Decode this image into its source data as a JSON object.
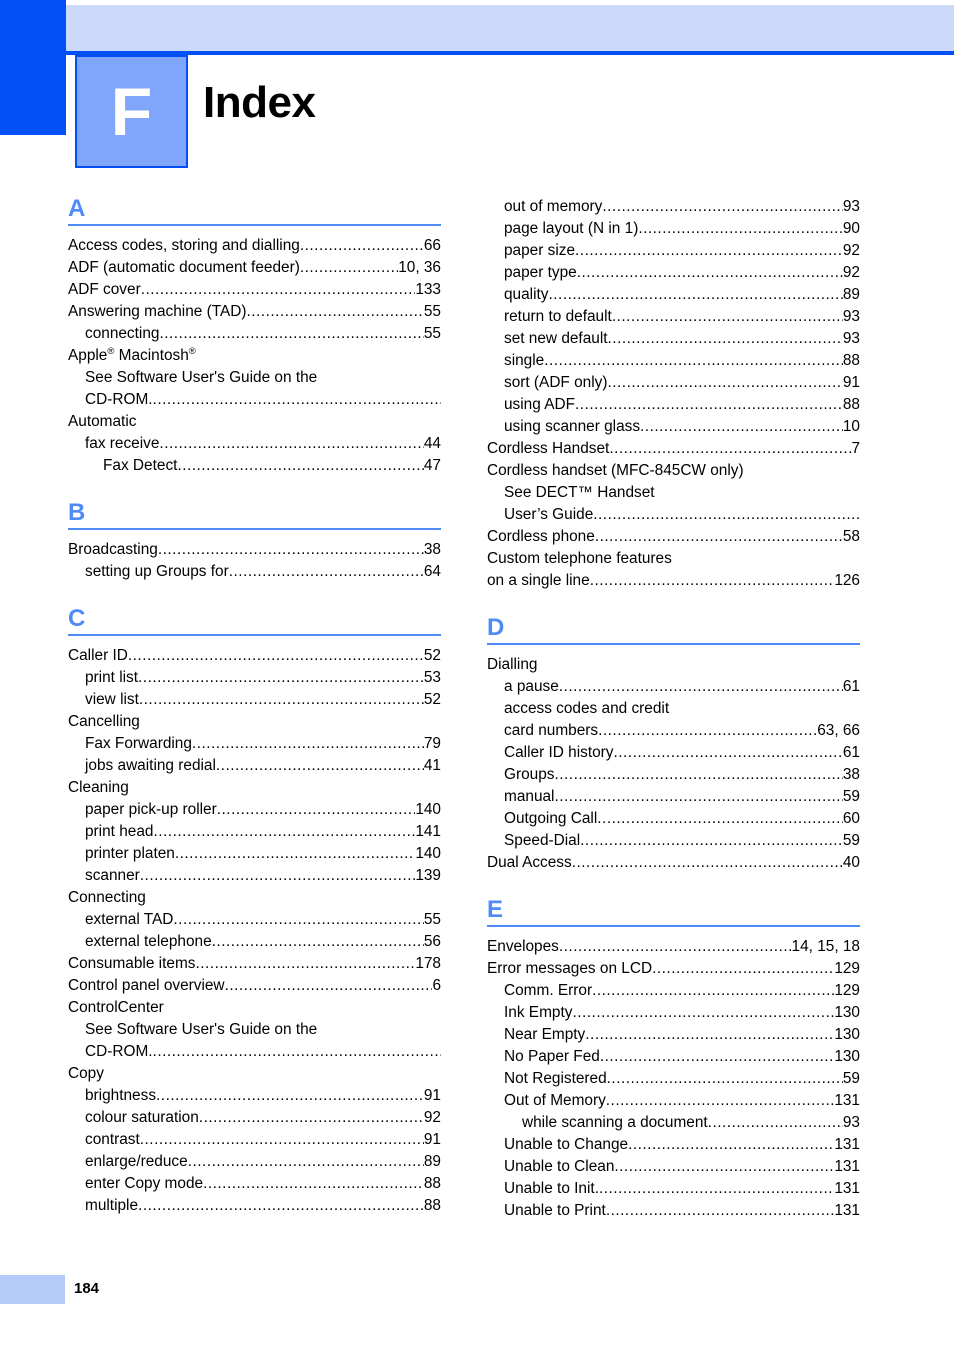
{
  "header": {
    "chapter_letter": "F",
    "title": "Index",
    "accent_dark": "#0050f5",
    "accent_band": "#cbdafb",
    "accent_tab": "#80a6fb"
  },
  "footer": {
    "page_number": "184",
    "bar_color": "#b4caf9"
  },
  "columns": [
    {
      "id": "left",
      "sections": [
        {
          "letter": "A",
          "entries": [
            {
              "level": 1,
              "label": "Access codes, storing and dialling",
              "page": "66",
              "dots": true
            },
            {
              "level": 1,
              "label": "ADF (automatic document feeder)",
              "page": "10, 36",
              "dots": true
            },
            {
              "level": 1,
              "label": "ADF cover",
              "page": "133",
              "dots": true
            },
            {
              "level": 1,
              "label": "Answering machine (TAD)",
              "page": "55",
              "dots": true
            },
            {
              "level": 2,
              "label": "connecting",
              "page": "55",
              "dots": true
            },
            {
              "level": 1,
              "label": "Apple® Macintosh®",
              "page": "",
              "dots": false,
              "html": true
            },
            {
              "level": 2,
              "label": "See Software User's Guide on the",
              "page": "",
              "dots": false
            },
            {
              "level": 2,
              "label": "CD-ROM.",
              "page": "",
              "dots": true
            },
            {
              "level": 1,
              "label": "Automatic",
              "page": "",
              "dots": false
            },
            {
              "level": 2,
              "label": "fax receive",
              "page": "44",
              "dots": true
            },
            {
              "level": 3,
              "label": "Fax Detect",
              "page": "47",
              "dots": true
            }
          ]
        },
        {
          "letter": "B",
          "entries": [
            {
              "level": 1,
              "label": "Broadcasting",
              "page": "38",
              "dots": true
            },
            {
              "level": 2,
              "label": "setting up Groups for",
              "page": "64",
              "dots": true
            }
          ]
        },
        {
          "letter": "C",
          "entries": [
            {
              "level": 1,
              "label": "Caller ID",
              "page": "52",
              "dots": true
            },
            {
              "level": 2,
              "label": "print list",
              "page": "53",
              "dots": true
            },
            {
              "level": 2,
              "label": "view list",
              "page": "52",
              "dots": true
            },
            {
              "level": 1,
              "label": "Cancelling",
              "page": "",
              "dots": false
            },
            {
              "level": 2,
              "label": "Fax Forwarding",
              "page": "79",
              "dots": true
            },
            {
              "level": 2,
              "label": "jobs awaiting redial",
              "page": "41",
              "dots": true
            },
            {
              "level": 1,
              "label": "Cleaning",
              "page": "",
              "dots": false
            },
            {
              "level": 2,
              "label": "paper pick-up roller",
              "page": "140",
              "dots": true
            },
            {
              "level": 2,
              "label": "print head",
              "page": "141",
              "dots": true
            },
            {
              "level": 2,
              "label": "printer platen",
              "page": "140",
              "dots": true
            },
            {
              "level": 2,
              "label": "scanner",
              "page": "139",
              "dots": true
            },
            {
              "level": 1,
              "label": "Connecting",
              "page": "",
              "dots": false
            },
            {
              "level": 2,
              "label": "external TAD",
              "page": "55",
              "dots": true
            },
            {
              "level": 2,
              "label": "external telephone",
              "page": "56",
              "dots": true
            },
            {
              "level": 1,
              "label": "Consumable items",
              "page": "178",
              "dots": true
            },
            {
              "level": 1,
              "label": "Control panel overview",
              "page": "6",
              "dots": true
            },
            {
              "level": 1,
              "label": "ControlCenter",
              "page": "",
              "dots": false
            },
            {
              "level": 2,
              "label": "See Software User's Guide on the",
              "page": "",
              "dots": false
            },
            {
              "level": 2,
              "label": "CD-ROM.",
              "page": "",
              "dots": true
            },
            {
              "level": 1,
              "label": "Copy",
              "page": "",
              "dots": false
            },
            {
              "level": 2,
              "label": "brightness",
              "page": "91",
              "dots": true
            },
            {
              "level": 2,
              "label": "colour saturation",
              "page": "92",
              "dots": true
            },
            {
              "level": 2,
              "label": "contrast",
              "page": "91",
              "dots": true
            },
            {
              "level": 2,
              "label": "enlarge/reduce",
              "page": "89",
              "dots": true
            },
            {
              "level": 2,
              "label": "enter Copy mode",
              "page": "88",
              "dots": true
            },
            {
              "level": 2,
              "label": "multiple",
              "page": "88",
              "dots": true
            }
          ]
        }
      ]
    },
    {
      "id": "right",
      "sections": [
        {
          "letter": "",
          "entries": [
            {
              "level": 2,
              "label": "out of memory",
              "page": "93",
              "dots": true
            },
            {
              "level": 2,
              "label": "page layout (N in 1)",
              "page": "90",
              "dots": true
            },
            {
              "level": 2,
              "label": "paper size",
              "page": "92",
              "dots": true
            },
            {
              "level": 2,
              "label": "paper type",
              "page": "92",
              "dots": true
            },
            {
              "level": 2,
              "label": "quality",
              "page": "89",
              "dots": true
            },
            {
              "level": 2,
              "label": "return to default",
              "page": "93",
              "dots": true
            },
            {
              "level": 2,
              "label": "set new default",
              "page": "93",
              "dots": true
            },
            {
              "level": 2,
              "label": "single",
              "page": "88",
              "dots": true
            },
            {
              "level": 2,
              "label": "sort (ADF only)",
              "page": "91",
              "dots": true
            },
            {
              "level": 2,
              "label": "using ADF",
              "page": "88",
              "dots": true
            },
            {
              "level": 2,
              "label": "using scanner glass",
              "page": "10",
              "dots": true
            },
            {
              "level": 1,
              "label": "Cordless Handset",
              "page": "7",
              "dots": true
            },
            {
              "level": 1,
              "label": "Cordless handset (MFC-845CW only)",
              "page": "",
              "dots": false
            },
            {
              "level": 2,
              "label": "See DECT™ Handset",
              "page": "",
              "dots": false
            },
            {
              "level": 2,
              "label": "User’s Guide",
              "page": "",
              "dots": true
            },
            {
              "level": 1,
              "label": "Cordless phone",
              "page": "58",
              "dots": true
            },
            {
              "level": 1,
              "label": "Custom telephone features",
              "page": "",
              "dots": false
            },
            {
              "level": 1,
              "label": "on a single line",
              "page": "126",
              "dots": true
            }
          ]
        },
        {
          "letter": "D",
          "entries": [
            {
              "level": 1,
              "label": "Dialling",
              "page": "",
              "dots": false
            },
            {
              "level": 2,
              "label": "a pause",
              "page": "61",
              "dots": true
            },
            {
              "level": 2,
              "label": "access codes and credit",
              "page": "",
              "dots": false
            },
            {
              "level": 2,
              "label": "card numbers",
              "page": "63, 66",
              "dots": true
            },
            {
              "level": 2,
              "label": "Caller ID history",
              "page": "61",
              "dots": true
            },
            {
              "level": 2,
              "label": "Groups",
              "page": "38",
              "dots": true
            },
            {
              "level": 2,
              "label": "manual",
              "page": "59",
              "dots": true
            },
            {
              "level": 2,
              "label": "Outgoing Call",
              "page": "60",
              "dots": true
            },
            {
              "level": 2,
              "label": "Speed-Dial",
              "page": "59",
              "dots": true
            },
            {
              "level": 1,
              "label": "Dual Access",
              "page": "40",
              "dots": true
            }
          ]
        },
        {
          "letter": "E",
          "entries": [
            {
              "level": 1,
              "label": "Envelopes",
              "page": "14, 15, 18",
              "dots": true
            },
            {
              "level": 1,
              "label": "Error messages on LCD",
              "page": "129",
              "dots": true
            },
            {
              "level": 2,
              "label": "Comm. Error",
              "page": "129",
              "dots": true
            },
            {
              "level": 2,
              "label": "Ink Empty",
              "page": "130",
              "dots": true
            },
            {
              "level": 2,
              "label": "Near Empty",
              "page": "130",
              "dots": true
            },
            {
              "level": 2,
              "label": "No Paper Fed",
              "page": "130",
              "dots": true
            },
            {
              "level": 2,
              "label": "Not Registered",
              "page": "59",
              "dots": true
            },
            {
              "level": 2,
              "label": "Out of Memory",
              "page": "131",
              "dots": true
            },
            {
              "level": 3,
              "label": "while scanning a document",
              "page": "93",
              "dots": true
            },
            {
              "level": 2,
              "label": "Unable to Change",
              "page": "131",
              "dots": true
            },
            {
              "level": 2,
              "label": "Unable to Clean",
              "page": "131",
              "dots": true
            },
            {
              "level": 2,
              "label": "Unable to Init.",
              "page": "131",
              "dots": true
            },
            {
              "level": 2,
              "label": "Unable to Print",
              "page": "131",
              "dots": true
            }
          ]
        }
      ]
    }
  ]
}
